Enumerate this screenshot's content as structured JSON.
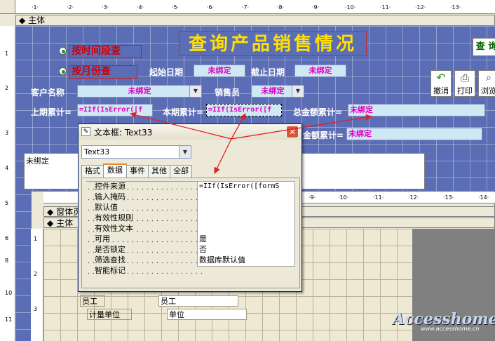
{
  "form": {
    "section_main": "主体",
    "title": "查询产品销售情况",
    "radio_by_date": "按时间段查",
    "radio_by_month": "按月份查",
    "start_date_label": "起始日期",
    "start_date_value": "未绑定",
    "end_date_label": "截止日期",
    "end_date_value": "未绑定",
    "customer_label": "客户名称",
    "customer_value": "未绑定",
    "salesperson_label": "销售员",
    "salesperson_value": "未绑定",
    "prev_total_label": "上期累计=",
    "prev_total_value": "=IIf(IsError([f",
    "curr_total_label": "本期累计=",
    "curr_total_value": "=IIf(IsError([f",
    "amount_total_label": "总金额累计=",
    "amount_total_value": "未绑定",
    "amount_total2_label": "金额累计=",
    "amount_total2_value": "未绑定",
    "query_button": "查 询",
    "undo_label": "撤消",
    "print_label": "打印",
    "browse_label": "浏览",
    "unbound_label": "未绑定"
  },
  "subform": {
    "section_header": "窗体页",
    "section_main": "主体",
    "staff_label": "员工",
    "staff_value": "员工",
    "unit_label": "计量单位",
    "unit_value": "单位"
  },
  "dialog": {
    "title": "文本框: Text33",
    "object_select": "Text33",
    "tabs": [
      "格式",
      "数据",
      "事件",
      "其他",
      "全部"
    ],
    "active_tab": "数据",
    "properties": [
      {
        "name": "控件来源",
        "value": "=IIf(IsError([formS"
      },
      {
        "name": "输入掩码",
        "value": ""
      },
      {
        "name": "默认值",
        "value": ""
      },
      {
        "name": "有效性规则",
        "value": ""
      },
      {
        "name": "有效性文本",
        "value": ""
      },
      {
        "name": "可用",
        "value": "是"
      },
      {
        "name": "是否锁定",
        "value": "否"
      },
      {
        "name": "筛选查找",
        "value": "数据库默认值"
      },
      {
        "name": "智能标记",
        "value": ""
      }
    ]
  },
  "watermark": {
    "brand": "Accesshome",
    "url": "www.accesshome.cn"
  },
  "colors": {
    "form_background": "#5a6db5",
    "field_text": "#e000c0",
    "label_red": "#d00000",
    "title_text": "#ffe000",
    "arrow_red": "#e02020"
  }
}
